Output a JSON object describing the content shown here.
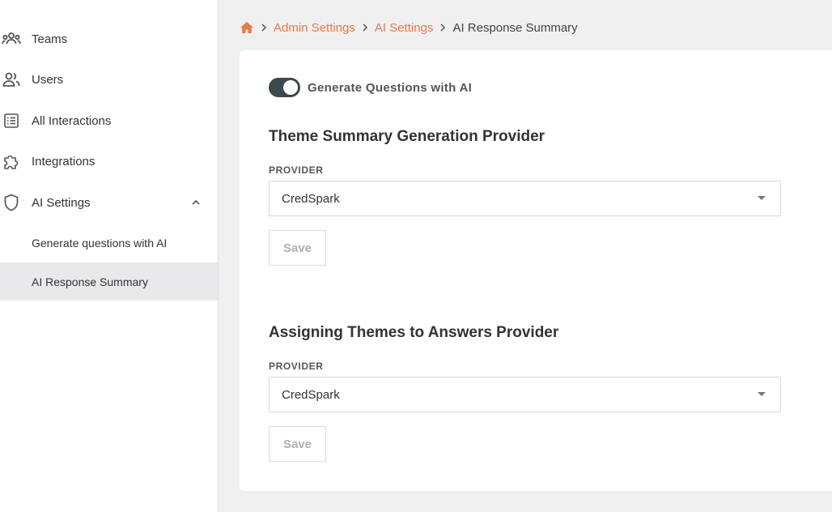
{
  "sidebar": {
    "items": [
      {
        "label": "Teams",
        "icon": "teams-icon"
      },
      {
        "label": "Users",
        "icon": "users-icon"
      },
      {
        "label": "All Interactions",
        "icon": "list-icon"
      },
      {
        "label": "Integrations",
        "icon": "puzzle-icon"
      },
      {
        "label": "AI Settings",
        "icon": "shield-icon",
        "expanded": true
      }
    ],
    "sub_items": [
      {
        "label": "Generate questions with AI",
        "active": false
      },
      {
        "label": "AI Response Summary",
        "active": true
      }
    ]
  },
  "breadcrumb": {
    "home_icon": "home-icon",
    "items": [
      "Admin Settings",
      "AI Settings"
    ],
    "current": "AI Response Summary"
  },
  "toggle": {
    "label": "Generate Questions with AI",
    "on": true
  },
  "sections": [
    {
      "title": "Theme Summary Generation Provider",
      "field_label": "PROVIDER",
      "value": "CredSpark",
      "save_label": "Save"
    },
    {
      "title": "Assigning Themes to Answers Provider",
      "field_label": "PROVIDER",
      "value": "CredSpark",
      "save_label": "Save"
    }
  ],
  "colors": {
    "accent": "#e97a4c",
    "toggle_on": "#3a4a50",
    "active_bg": "#e9e9ec"
  }
}
